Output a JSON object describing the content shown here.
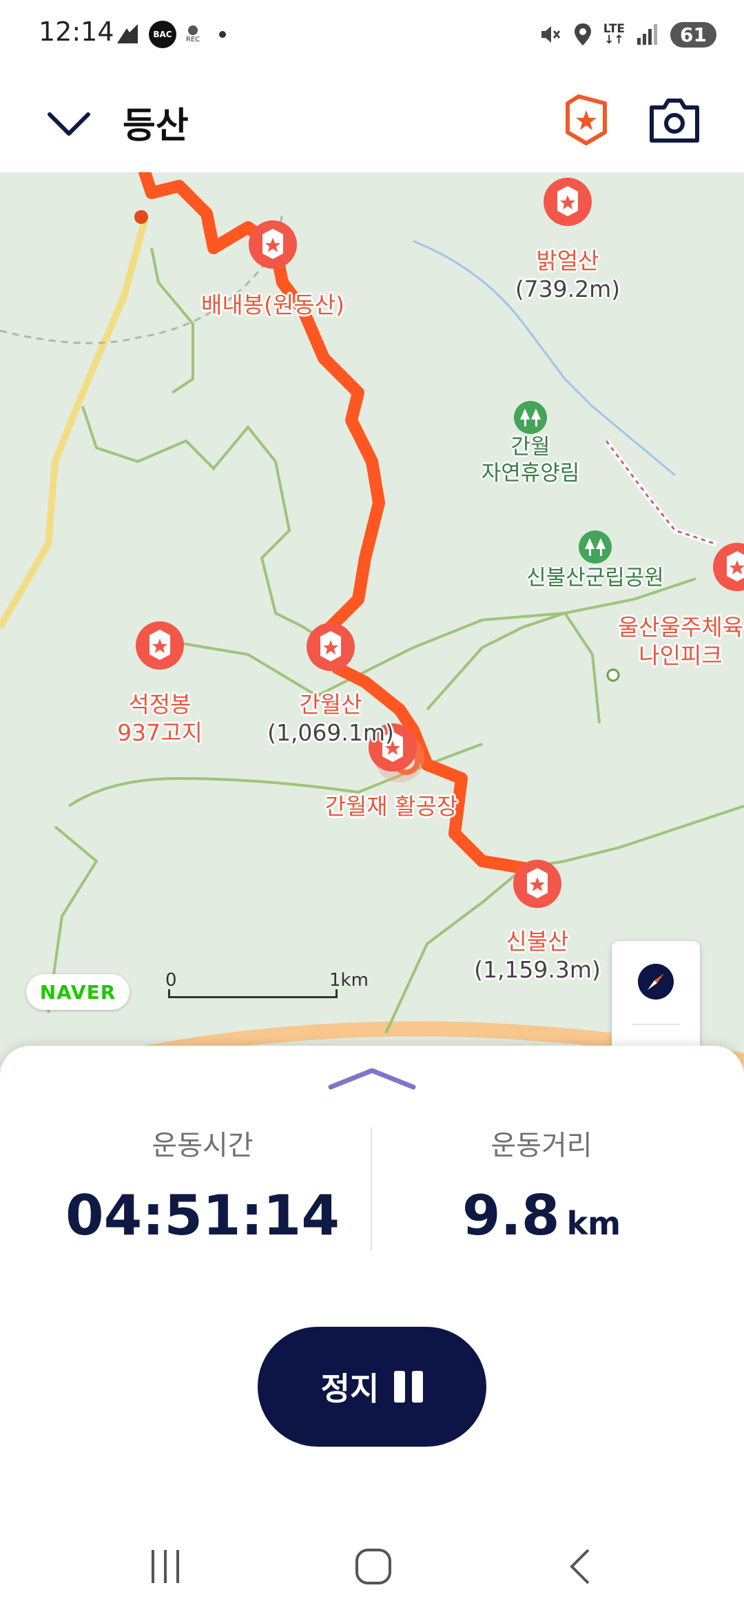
{
  "status_bar": {
    "time": "12:14",
    "badge_text": "BAC",
    "rec_text": "REC",
    "network": "LTE",
    "battery": "61"
  },
  "header": {
    "title": "등산",
    "back_icon": "chevron-down-icon",
    "mountain_icon": "mountain-badge-icon",
    "camera_icon": "camera-icon",
    "accent_color": "#f05a28"
  },
  "map": {
    "route_color": "#ff5722",
    "pois": [
      {
        "name": "밝얼산",
        "sub": "(739.2m)"
      },
      {
        "name": "배내봉(원동산)",
        "sub": ""
      },
      {
        "name": "석정봉",
        "sub": "937고지"
      },
      {
        "name": "간월산",
        "sub": "(1,069.1m)"
      },
      {
        "name": "간월재 활공장",
        "sub": ""
      },
      {
        "name": "신불산",
        "sub": "(1,159.3m)"
      },
      {
        "name": "울산울주체육",
        "sub": "나인피크"
      }
    ],
    "parks": [
      {
        "name": "간월",
        "sub": "자연휴양림"
      },
      {
        "name": "신불산군립공원",
        "sub": ""
      }
    ],
    "provider_logo": "NAVER",
    "scale_start": "0",
    "scale_end": "1km",
    "controls": [
      "compass-icon",
      "terrain-toggle-icon",
      "locate-icon"
    ]
  },
  "stats": {
    "time_label": "운동시간",
    "time_value": "04:51:14",
    "distance_label": "운동거리",
    "distance_value": "9.8",
    "distance_unit": "km"
  },
  "stop_button": {
    "label": "정지",
    "icon": "pause-icon"
  },
  "nav": [
    "recent-apps-icon",
    "home-icon",
    "back-icon"
  ]
}
